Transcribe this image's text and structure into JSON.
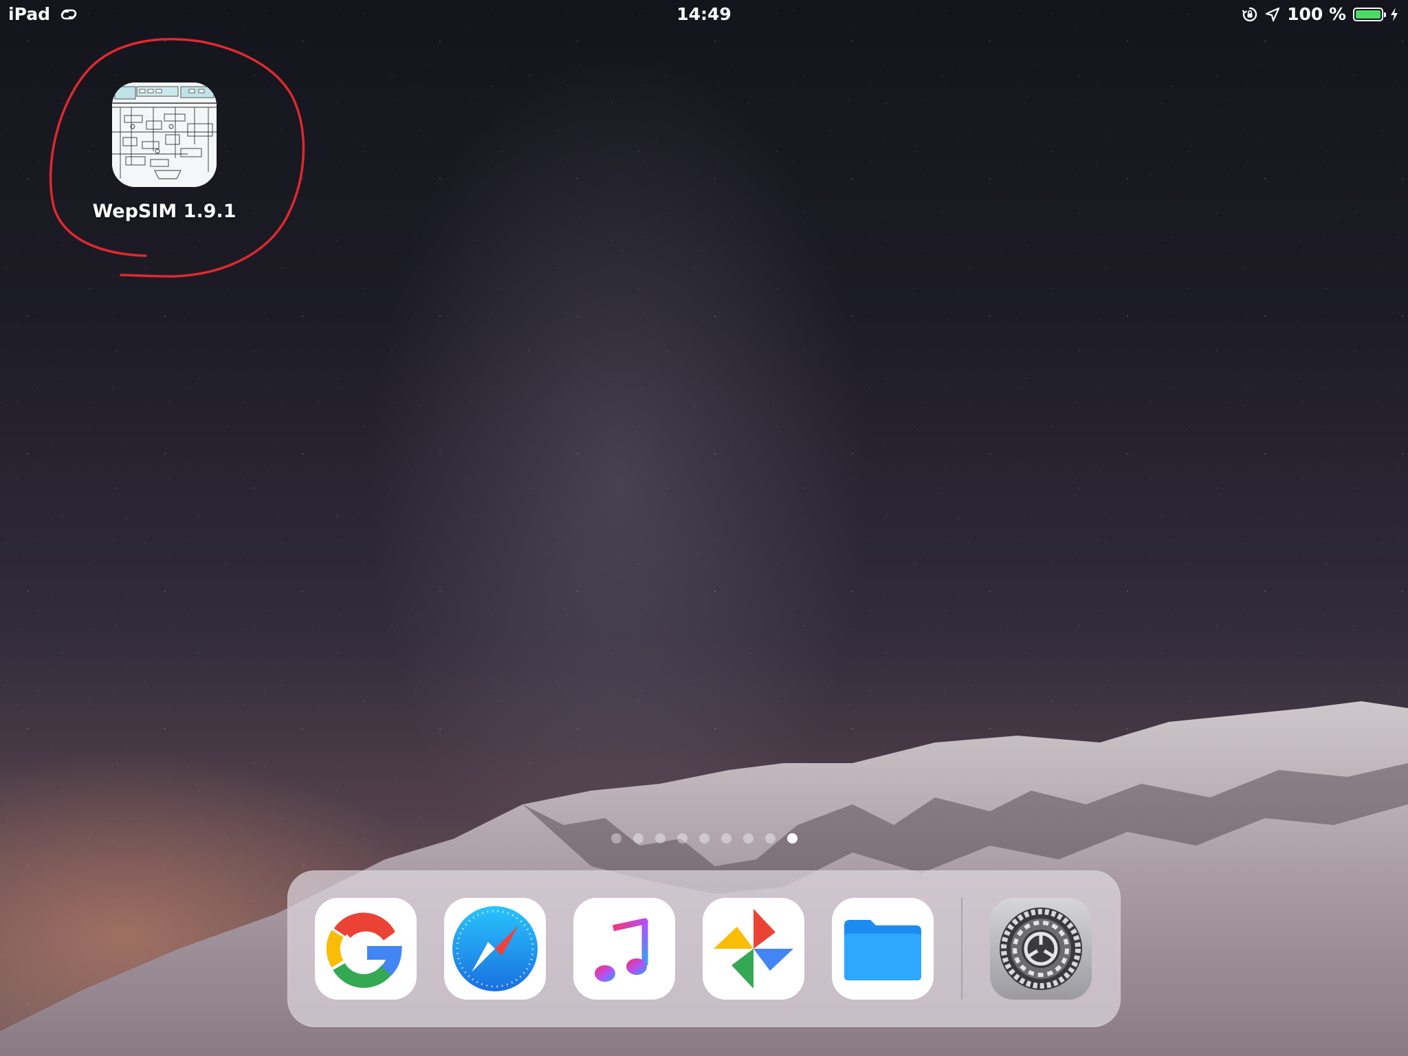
{
  "status_bar": {
    "device": "iPad",
    "time": "14:49",
    "battery": "100 %",
    "battery_level": 1.0,
    "battery_color": "#4cd964"
  },
  "home_screen": {
    "apps": [
      {
        "label": "WepSIM 1.9.1",
        "icon": "wepsim-circuit-icon"
      }
    ],
    "annotation_color": "#e0282f"
  },
  "page_indicator": {
    "count": 9,
    "active_index": 8
  },
  "dock": {
    "apps": [
      {
        "name": "Google",
        "icon": "google-icon"
      },
      {
        "name": "Safari",
        "icon": "safari-compass-icon"
      },
      {
        "name": "Music",
        "icon": "music-note-icon"
      },
      {
        "name": "Photos",
        "icon": "photos-pinwheel-icon"
      },
      {
        "name": "Files",
        "icon": "files-folder-icon"
      },
      {
        "name": "Settings",
        "icon": "settings-gear-icon"
      }
    ]
  }
}
